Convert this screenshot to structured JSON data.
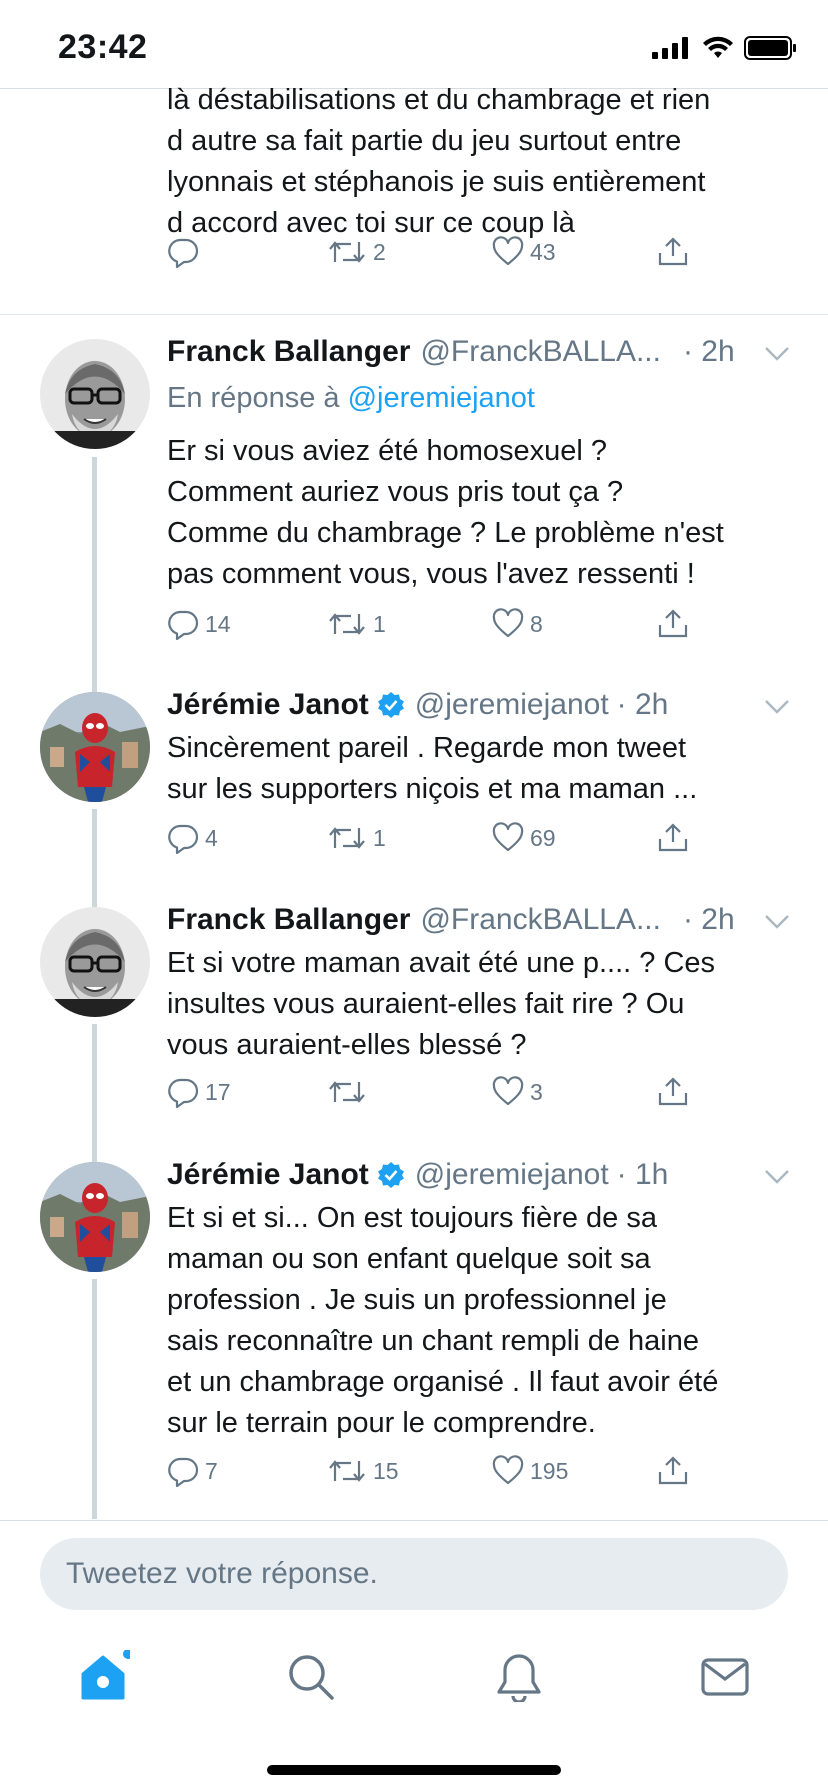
{
  "status_bar": {
    "time": "23:42"
  },
  "tweets": [
    {
      "text": "là déstabilisations et du chambrage et rien\nd autre sa fait partie du jeu surtout entre\nlyonnais et stéphanois je suis entièrement\nd accord avec toi sur ce coup là",
      "replies": "",
      "retweets": "2",
      "likes": "43"
    },
    {
      "name": "Franck Ballanger",
      "handle": "@FranckBALLA...",
      "time": "· 2h",
      "reply_prefix": "En réponse à",
      "reply_to": "@jeremiejanot",
      "text": "Er si vous aviez été homosexuel ?\nComment auriez vous pris tout ça ?\nComme du chambrage ? Le problème n'est\npas comment vous, vous l'avez ressenti !",
      "replies": "14",
      "retweets": "1",
      "likes": "8"
    },
    {
      "name": "Jérémie Janot",
      "handle": "@jeremiejanot",
      "time": "· 2h",
      "text": "Sincèrement pareil . Regarde mon tweet\nsur les supporters niçois et ma maman ...",
      "replies": "4",
      "retweets": "1",
      "likes": "69"
    },
    {
      "name": "Franck Ballanger",
      "handle": "@FranckBALLA...",
      "time": "· 2h",
      "text": "Et si votre maman avait été une p.... ? Ces\ninsultes vous auraient-elles fait rire ? Ou\nvous auraient-elles blessé ?",
      "replies": "17",
      "retweets": "",
      "likes": "3"
    },
    {
      "name": "Jérémie Janot",
      "handle": "@jeremiejanot",
      "time": "· 1h",
      "text": "Et si et si... On est toujours fière de sa\nmaman ou son enfant quelque soit sa\nprofession . Je suis un professionnel je\nsais reconnaître un chant rempli de haine\net un chambrage organisé . Il faut avoir été\nsur le terrain pour le comprendre.",
      "replies": "7",
      "retweets": "15",
      "likes": "195"
    }
  ],
  "composer": {
    "placeholder": "Tweetez votre réponse."
  },
  "icons": {
    "reply": "reply-icon",
    "retweet": "retweet-icon",
    "like": "heart-icon",
    "share": "share-icon",
    "tabs": [
      "home-icon",
      "search-icon",
      "notifications-icon",
      "messages-icon"
    ]
  },
  "colors": {
    "accent": "#1da1f2",
    "muted": "#657786",
    "text": "#14171a"
  }
}
